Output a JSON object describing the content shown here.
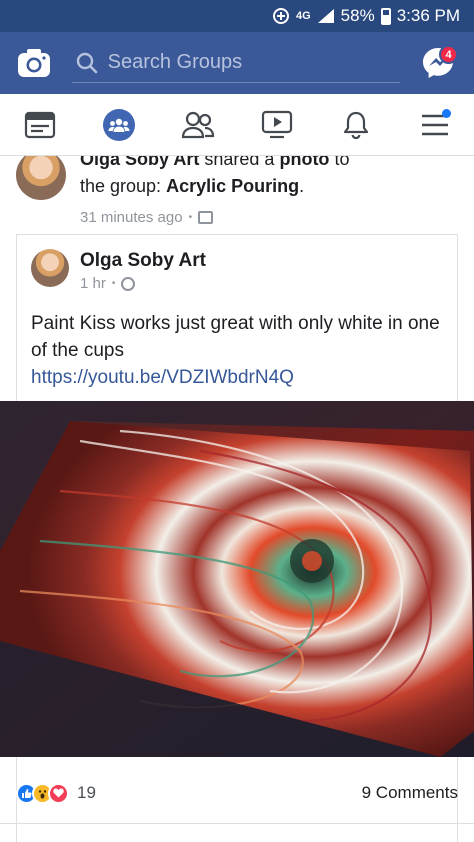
{
  "status_bar": {
    "network": "4G",
    "battery": "58%",
    "time": "3:36 PM"
  },
  "app_bar": {
    "search_placeholder": "Search Groups",
    "messenger_badge": "4"
  },
  "tabs": [
    {
      "name": "news-feed",
      "icon": "newsfeed-icon",
      "active": false
    },
    {
      "name": "groups",
      "icon": "groups-icon",
      "active": true
    },
    {
      "name": "friends",
      "icon": "friends-icon",
      "active": false
    },
    {
      "name": "watch",
      "icon": "video-icon",
      "active": false
    },
    {
      "name": "notifications",
      "icon": "bell-icon",
      "active": false
    },
    {
      "name": "menu",
      "icon": "hamburger-icon",
      "active": false
    }
  ],
  "share_header": {
    "author": "Olga Soby Art",
    "action": "shared a",
    "object": "photo",
    "to_prefix": "to",
    "line2_prefix": "the group:",
    "group": "Acrylic Pouring",
    "line2_suffix": ".",
    "time": "31 minutes ago"
  },
  "post": {
    "author": "Olga Soby Art",
    "time": "1 hr",
    "text": "Paint Kiss works just great with only white in one of the cups",
    "link": "https://youtu.be/VDZIWbdrN4Q"
  },
  "engagement": {
    "reaction_count": "19",
    "comments": "9 Comments"
  },
  "colors": {
    "brand": "#3b5998",
    "status_bar": "#29487d",
    "link": "#365899",
    "badge": "#f02849"
  }
}
